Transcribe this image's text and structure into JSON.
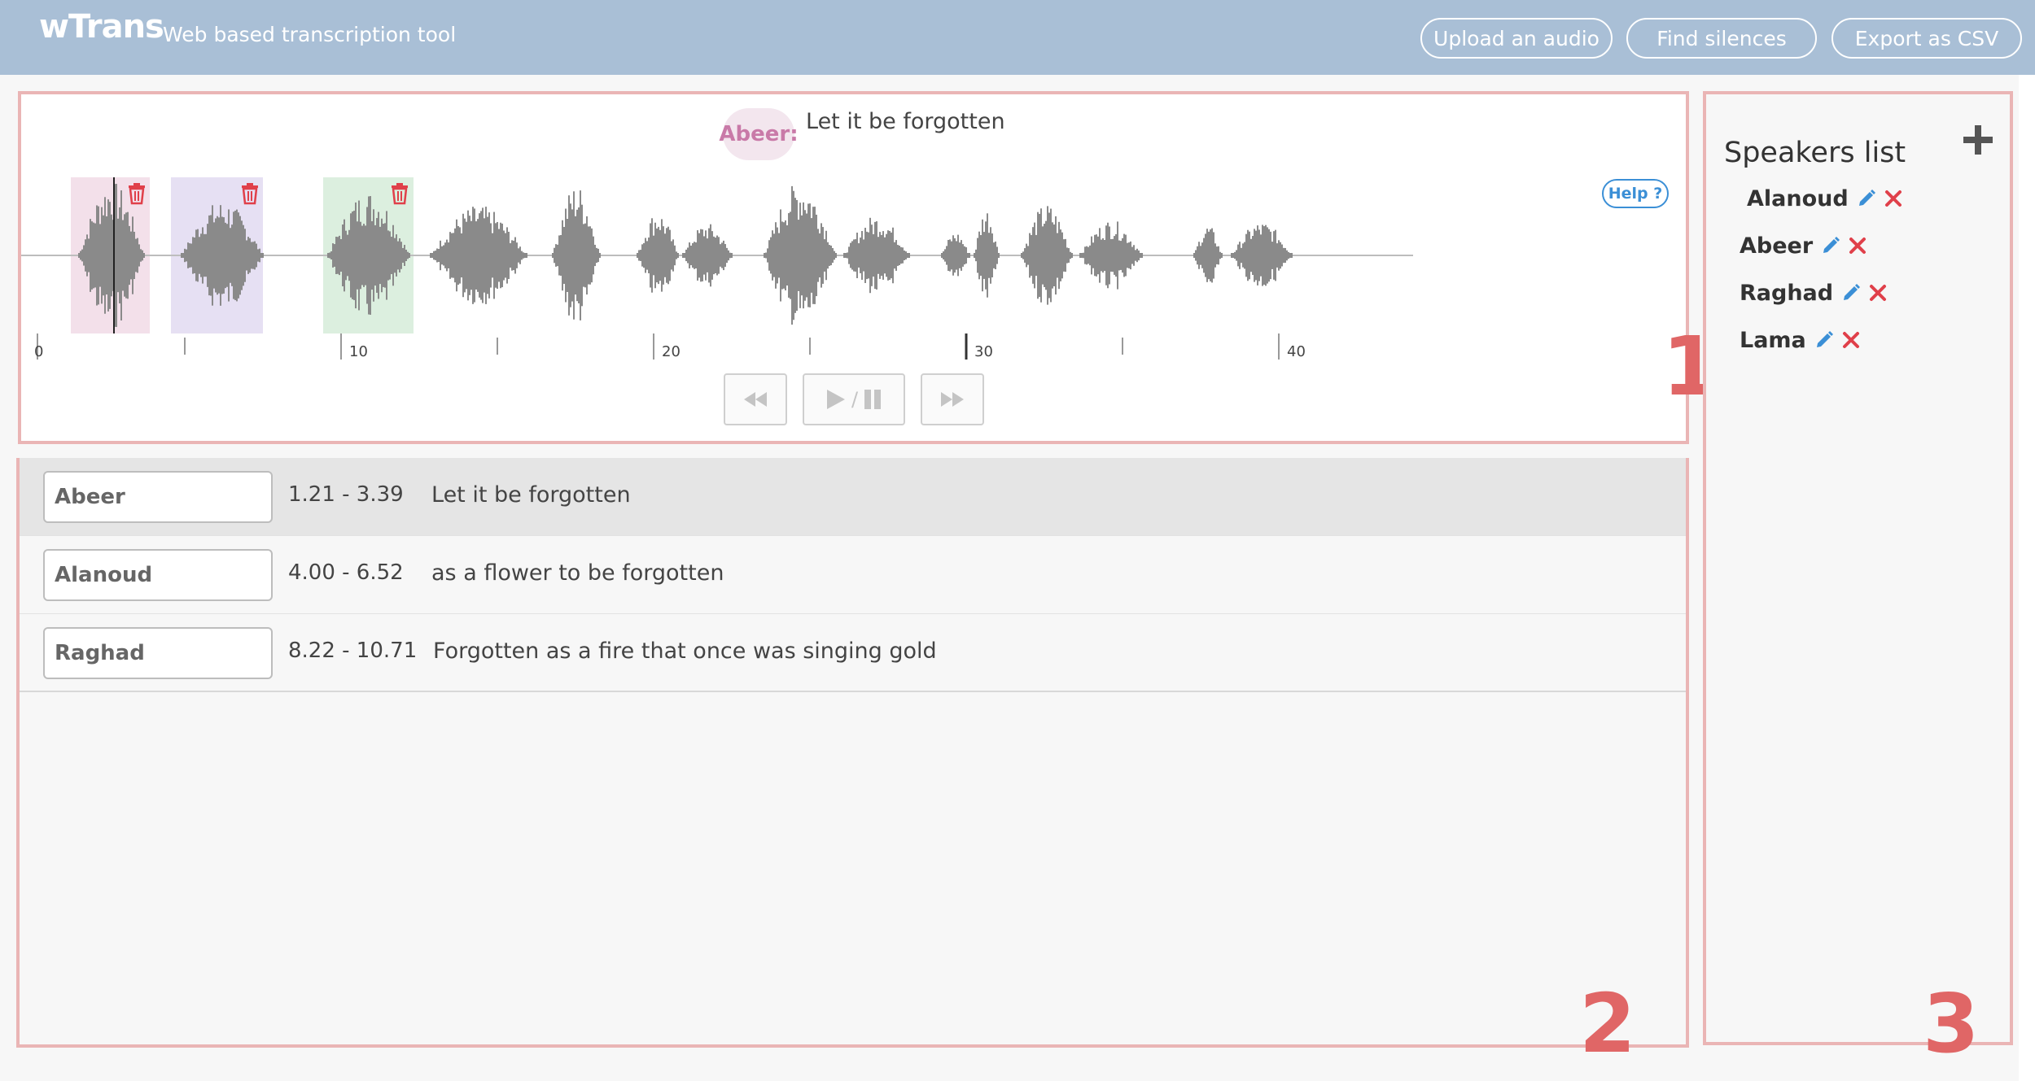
{
  "header": {
    "logo": "wTrans",
    "tagline": "Web based transcription tool",
    "buttons": [
      "Upload an audio",
      "Find silences",
      "Export as CSV"
    ]
  },
  "player": {
    "current_speaker": "Abeer:",
    "current_text": "Let it be forgotten",
    "help_label": "Help ?",
    "ticks": [
      "0",
      "10",
      "20",
      "30",
      "40"
    ],
    "play_pause_separator": "/"
  },
  "transcript": {
    "rows": [
      {
        "speaker": "Abeer",
        "time": "1.21 - 3.39",
        "text": "Let it be forgotten"
      },
      {
        "speaker": "Alanoud",
        "time": "4.00 - 6.52",
        "text": "as a flower to be forgotten"
      },
      {
        "speaker": "Raghad",
        "time": "8.22 - 10.71",
        "text": "Forgotten as a fire that once was singing gold"
      }
    ]
  },
  "speakers": {
    "title": "Speakers list",
    "items": [
      "Alanoud",
      "Abeer",
      "Raghad",
      "Lama"
    ]
  },
  "panel_numbers": [
    "1",
    "2",
    "3"
  ],
  "colors": {
    "header_bg": "#a9bfd6",
    "panel_border": "#eab5b5",
    "panel_number": "#e06666",
    "accent_blue": "#3b8fd6",
    "delete_red": "#e0404a",
    "region_pink": "#f3e0ea",
    "region_purple": "#e6e0f3",
    "region_green": "#dcefdf"
  },
  "icons": [
    "trash-icon",
    "rewind-icon",
    "play-icon",
    "pause-icon",
    "fast-forward-icon",
    "plus-icon",
    "pencil-icon",
    "delete-x-icon"
  ]
}
